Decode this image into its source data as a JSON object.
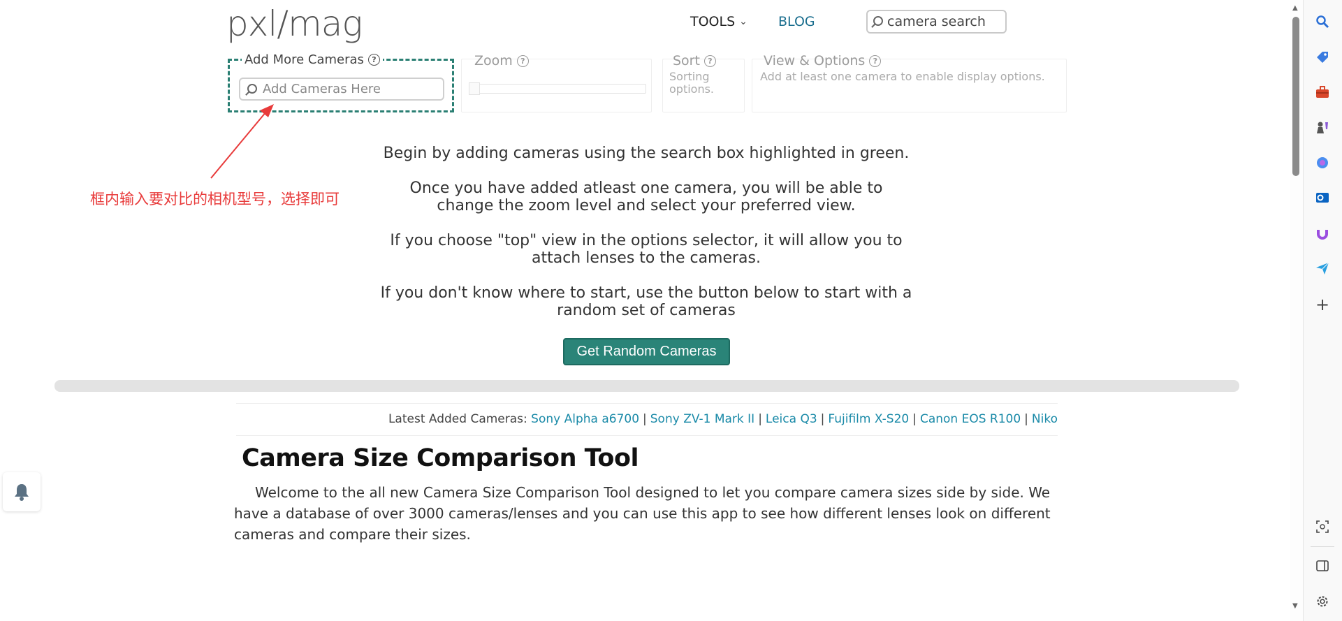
{
  "header": {
    "logo": "pxl/mag",
    "nav_tools": "TOOLS",
    "nav_blog": "BLOG",
    "search_placeholder": "camera search"
  },
  "controls": {
    "add_title": "Add More Cameras",
    "add_placeholder": "Add Cameras Here",
    "zoom_title": "Zoom",
    "sort_title": "Sort",
    "sort_hint": "Sorting options.",
    "view_title": "View & Options",
    "view_hint": "Add at least one camera to enable display options."
  },
  "intro": {
    "p1": "Begin by adding cameras using the search box highlighted in green.",
    "p2": "Once you have added atleast one camera, you will be able to change the zoom level and select your preferred view.",
    "p3": "If you choose \"top\" view in the options selector, it will allow you to attach lenses to the cameras.",
    "p4": "If you don't know where to start, use the button below to start with a random set of cameras",
    "button": "Get Random Cameras"
  },
  "latest": {
    "label": "Latest Added Cameras:",
    "cameras": [
      "Sony Alpha a6700",
      "Sony ZV-1 Mark II",
      "Leica Q3",
      "Fujifilm X-S20",
      "Canon EOS R100",
      "Niko"
    ]
  },
  "article": {
    "title": "Camera Size Comparison Tool",
    "body": "Welcome to the all new Camera Size Comparison Tool designed to let you compare camera sizes side by side. We have a database of over 3000 cameras/lenses and you can use this app to see how different lenses look on different cameras and compare their sizes."
  },
  "annotation": {
    "text": "框内输入要对比的相机型号，选择即可",
    "color": "#e83a3a"
  },
  "colors": {
    "accent": "#2a8478",
    "link": "#1a8aa8",
    "highlight_border": "#2a7f73"
  },
  "icons": [
    "search-icon",
    "help-icon",
    "chevron-down-icon",
    "bell-icon",
    "tag-icon",
    "briefcase-icon",
    "chess-icon",
    "copilot-icon",
    "outlook-icon",
    "magnet-icon",
    "send-icon",
    "plus-icon",
    "screenshot-icon",
    "split-view-icon",
    "gear-icon"
  ]
}
